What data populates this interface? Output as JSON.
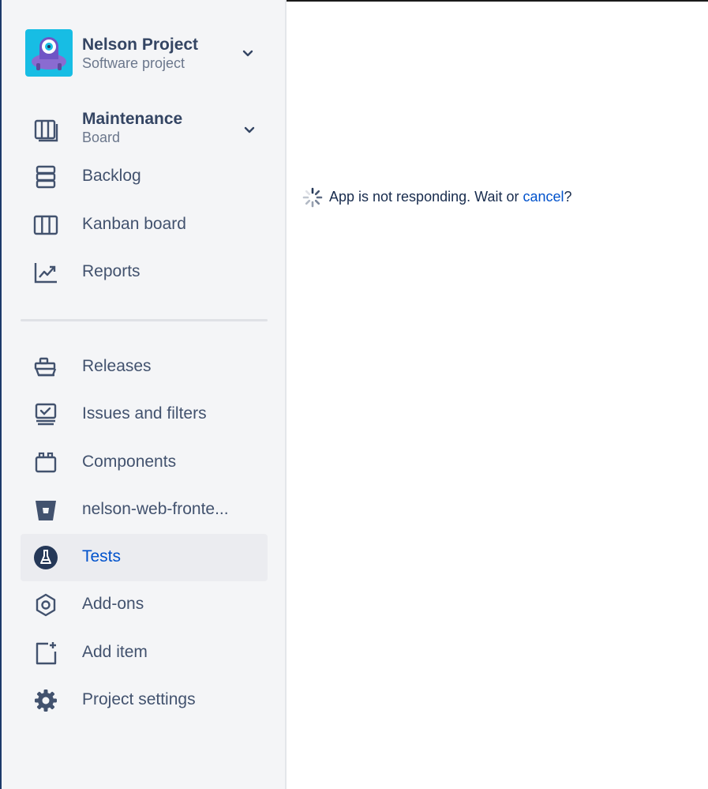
{
  "project": {
    "name": "Nelson Project",
    "type": "Software project",
    "avatar_color": "#17bde4"
  },
  "board_switcher": {
    "title": "Maintenance",
    "subtitle": "Board",
    "icon": "board-icon"
  },
  "nav_top": [
    {
      "label": "Backlog",
      "icon": "backlog-icon"
    },
    {
      "label": "Kanban board",
      "icon": "kanban-board-icon"
    },
    {
      "label": "Reports",
      "icon": "reports-icon"
    }
  ],
  "nav_bottom": [
    {
      "label": "Releases",
      "icon": "releases-icon"
    },
    {
      "label": "Issues and filters",
      "icon": "issues-filters-icon"
    },
    {
      "label": "Components",
      "icon": "components-icon"
    },
    {
      "label": "nelson-web-fronte...",
      "icon": "bitbucket-icon"
    },
    {
      "label": "Tests",
      "icon": "flask-icon",
      "active": true
    },
    {
      "label": "Add-ons",
      "icon": "add-ons-icon"
    },
    {
      "label": "Add item",
      "icon": "add-item-icon"
    },
    {
      "label": "Project settings",
      "icon": "gear-icon"
    }
  ],
  "main": {
    "message_prefix": "App is not responding. Wait or ",
    "cancel_link": "cancel",
    "message_suffix": "?"
  },
  "colors": {
    "sidebar_bg": "#f4f5f7",
    "active_bg": "#ebecf0",
    "active_text": "#0052cc",
    "text": "#42526e",
    "link": "#0052cc"
  }
}
